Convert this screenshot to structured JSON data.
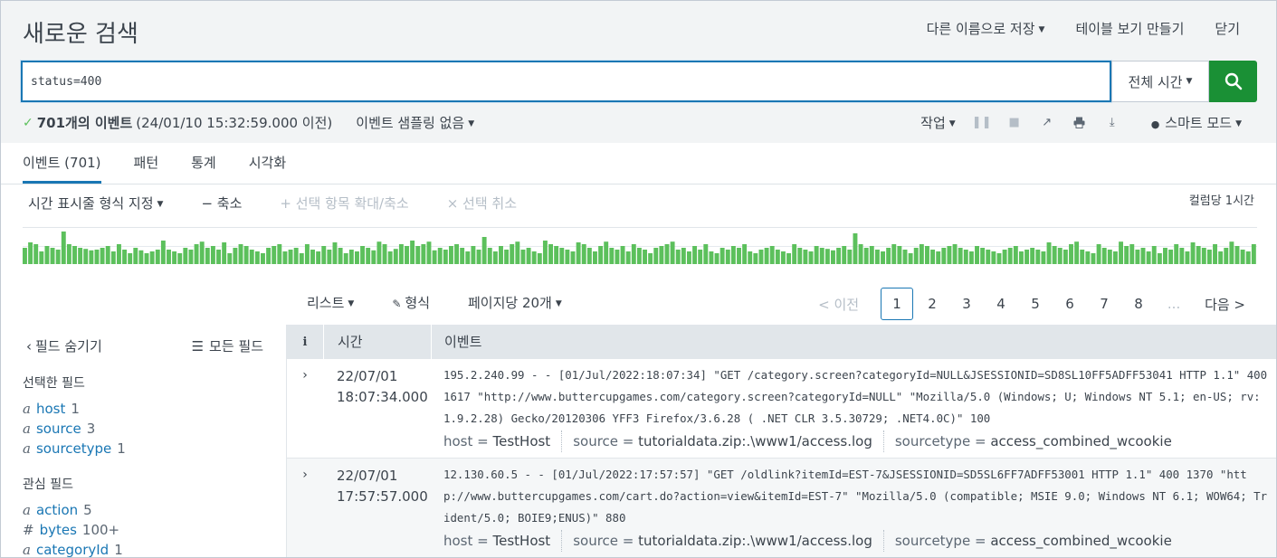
{
  "header": {
    "title": "새로운 검색",
    "save_as": "다른 이름으로 저장",
    "create_table_view": "테이블 보기 만들기",
    "close": "닫기"
  },
  "search": {
    "query": "status=400",
    "time_range": "전체 시간"
  },
  "status": {
    "check": "✓",
    "count": "701개의 이벤트",
    "as_of": "(24/01/10 15:32:59.000 이전)",
    "sampling": "이벤트 샘플링 없음"
  },
  "actions": {
    "job": "작업",
    "smart_mode": "스마트 모드"
  },
  "tabs": [
    {
      "label": "이벤트 (701)"
    },
    {
      "label": "패턴"
    },
    {
      "label": "통계"
    },
    {
      "label": "시각화"
    }
  ],
  "timeline_toolbar": {
    "format": "시간 표시줄 형식 지정",
    "zoom_out": "− 축소",
    "zoom_selection": "+ 선택 항목 확대/축소",
    "deselect": "× 선택 취소",
    "per_bucket": "컬럼당 1시간"
  },
  "timeline": {
    "color": "#5cc05c",
    "bar_levels": [
      0.45,
      0.6,
      0.55,
      0.35,
      0.5,
      0.45,
      0.4,
      0.9,
      0.55,
      0.5,
      0.45,
      0.42,
      0.38,
      0.4,
      0.45,
      0.5,
      0.35,
      0.55,
      0.4,
      0.3,
      0.45,
      0.38,
      0.3,
      0.35,
      0.4,
      0.65,
      0.4,
      0.35,
      0.3,
      0.45,
      0.4,
      0.55,
      0.62,
      0.45,
      0.5,
      0.4,
      0.6,
      0.3,
      0.45,
      0.55,
      0.5,
      0.4,
      0.35,
      0.3,
      0.45,
      0.5,
      0.55,
      0.35,
      0.4,
      0.45,
      0.3,
      0.55,
      0.4,
      0.35,
      0.5,
      0.4,
      0.6,
      0.45,
      0.3,
      0.4,
      0.35,
      0.5,
      0.45,
      0.38,
      0.62,
      0.55,
      0.35,
      0.42,
      0.55,
      0.5,
      0.65,
      0.5,
      0.55,
      0.62,
      0.38,
      0.45,
      0.4,
      0.5,
      0.55,
      0.45,
      0.35,
      0.5,
      0.4,
      0.75,
      0.45,
      0.35,
      0.5,
      0.4,
      0.55,
      0.62,
      0.4,
      0.45,
      0.35,
      0.3,
      0.65,
      0.55,
      0.5,
      0.45,
      0.4,
      0.35,
      0.6,
      0.55,
      0.45,
      0.35,
      0.5,
      0.62,
      0.45,
      0.4,
      0.5,
      0.35,
      0.55,
      0.45,
      0.4,
      0.3,
      0.45,
      0.5,
      0.55,
      0.62,
      0.4,
      0.45,
      0.35,
      0.5,
      0.4,
      0.55,
      0.35,
      0.3,
      0.45,
      0.4,
      0.5,
      0.45,
      0.55,
      0.35,
      0.3,
      0.4,
      0.45,
      0.5,
      0.4,
      0.35,
      0.3,
      0.55,
      0.45,
      0.4,
      0.35,
      0.5,
      0.45,
      0.42,
      0.38,
      0.45,
      0.5,
      0.4,
      0.85,
      0.55,
      0.45,
      0.5,
      0.4,
      0.35,
      0.45,
      0.55,
      0.5,
      0.4,
      0.3,
      0.45,
      0.55,
      0.5,
      0.4,
      0.35,
      0.45,
      0.5,
      0.55,
      0.45,
      0.4,
      0.35,
      0.5,
      0.45,
      0.4,
      0.35,
      0.3,
      0.4,
      0.45,
      0.5,
      0.35,
      0.4,
      0.45,
      0.4,
      0.35,
      0.6,
      0.5,
      0.45,
      0.4,
      0.55,
      0.62,
      0.4,
      0.35,
      0.3,
      0.55,
      0.45,
      0.4,
      0.35,
      0.62,
      0.5,
      0.55,
      0.4,
      0.45,
      0.35,
      0.5,
      0.3,
      0.45,
      0.4,
      0.55,
      0.45,
      0.35,
      0.6,
      0.5,
      0.45,
      0.4,
      0.55,
      0.35,
      0.45,
      0.62,
      0.5,
      0.4,
      0.35,
      0.55
    ]
  },
  "results_toolbar": {
    "list": "리스트",
    "format": "형식",
    "per_page": "페이지당 20개"
  },
  "pager": {
    "prev": "< 이전",
    "pages": [
      "1",
      "2",
      "3",
      "4",
      "5",
      "6",
      "7",
      "8"
    ],
    "ellipsis": "...",
    "next": "다음 >"
  },
  "sidebar": {
    "hide_fields": "필드 숨기기",
    "all_fields": "모든 필드",
    "selected_title": "선택한 필드",
    "selected": [
      {
        "type": "a",
        "name": "host",
        "count": "1"
      },
      {
        "type": "a",
        "name": "source",
        "count": "3"
      },
      {
        "type": "a",
        "name": "sourcetype",
        "count": "1"
      }
    ],
    "interesting_title": "관심 필드",
    "interesting": [
      {
        "type": "a",
        "name": "action",
        "count": "5"
      },
      {
        "type": "#",
        "name": "bytes",
        "count": "100+"
      },
      {
        "type": "a",
        "name": "categoryId",
        "count": "1"
      }
    ]
  },
  "table": {
    "col_info": "i",
    "col_time": "시간",
    "col_event": "이벤트"
  },
  "events": [
    {
      "date": "22/07/01",
      "time": "18:07:34.000",
      "raw": "195.2.240.99 - - [01/Jul/2022:18:07:34] \"GET /category.screen?categoryId=NULL&JSESSIONID=SD8SL10FF5ADFF53041 HTTP 1.1\" 400 1617 \"http://www.buttercupgames.com/category.screen?categoryId=NULL\" \"Mozilla/5.0 (Windows; U; Windows NT 5.1; en-US; rv:1.9.2.28) Gecko/20120306 YFF3 Firefox/3.6.28 ( .NET CLR 3.5.30729; .NET4.0C)\" 100",
      "host_k": "host =",
      "host_v": "TestHost",
      "source_k": "source =",
      "source_v": "tutorialdata.zip:.\\www1/access.log",
      "stype_k": "sourcetype =",
      "stype_v": "access_combined_wcookie"
    },
    {
      "date": "22/07/01",
      "time": "17:57:57.000",
      "raw": "12.130.60.5 - - [01/Jul/2022:17:57:57] \"GET /oldlink?itemId=EST-7&JSESSIONID=SD5SL6FF7ADFF53001 HTTP 1.1\" 400 1370 \"http://www.buttercupgames.com/cart.do?action=view&itemId=EST-7\" \"Mozilla/5.0 (compatible; MSIE 9.0; Windows NT 6.1; WOW64; Trident/5.0; BOIE9;ENUS)\" 880",
      "host_k": "host =",
      "host_v": "TestHost",
      "source_k": "source =",
      "source_v": "tutorialdata.zip:.\\www1/access.log",
      "stype_k": "sourcetype =",
      "stype_v": "access_combined_wcookie"
    }
  ]
}
